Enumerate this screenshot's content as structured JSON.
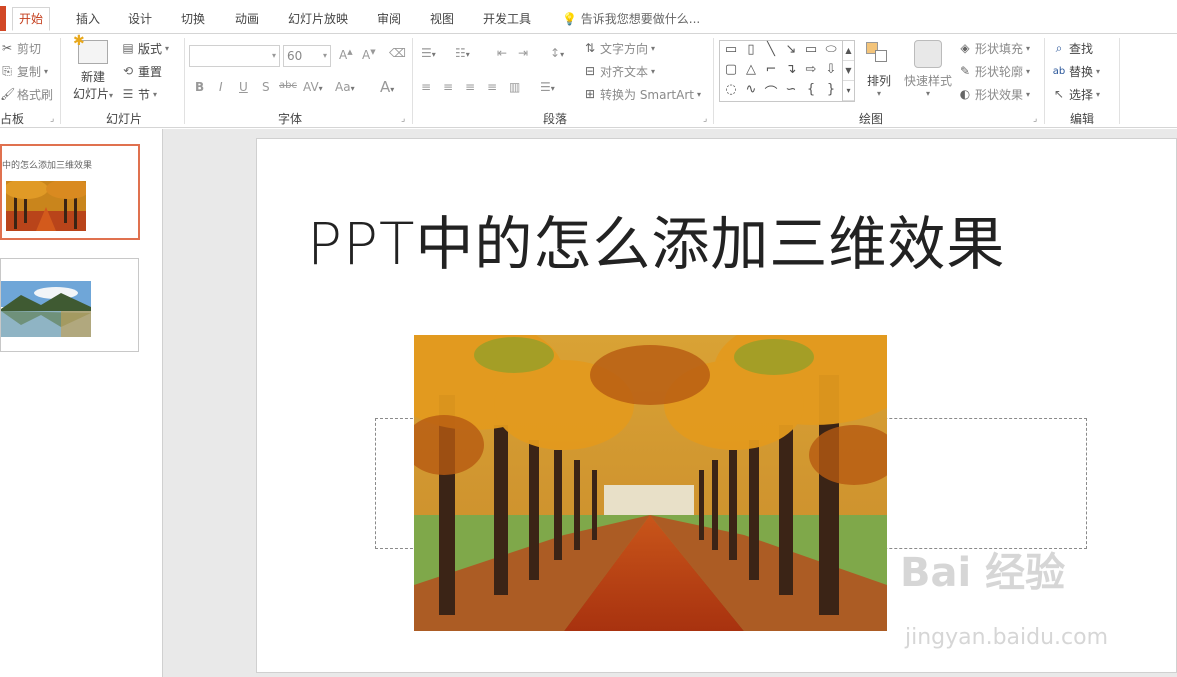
{
  "tabs": [
    "开始",
    "插入",
    "设计",
    "切换",
    "动画",
    "幻灯片放映",
    "审阅",
    "视图",
    "开发工具"
  ],
  "active_tab": "开始",
  "tell_me": "告诉我您想要做什么...",
  "clipboard": {
    "cut": "剪切",
    "copy": "复制",
    "format_painter": "格式刷",
    "label": "占板"
  },
  "slides_group": {
    "new_slide_1": "新建",
    "new_slide_2": "幻灯片",
    "layout": "版式",
    "reset": "重置",
    "section": "节",
    "label": "幻灯片"
  },
  "font_group": {
    "font_name": "",
    "font_size": "60",
    "label": "字体",
    "bold": "B",
    "italic": "I",
    "underline": "U",
    "shadow": "S",
    "strike": "abc",
    "spacing": "AV",
    "case": "Aa",
    "color": "A"
  },
  "paragraph_group": {
    "text_direction": "文字方向",
    "align_text": "对齐文本",
    "convert_smartart": "转换为 SmartArt",
    "label": "段落"
  },
  "drawing_group": {
    "arrange": "排列",
    "quick_styles": "快速样式",
    "shape_fill": "形状填充",
    "shape_outline": "形状轮廓",
    "shape_effects": "形状效果",
    "label": "绘图"
  },
  "editing_group": {
    "find": "查找",
    "replace": "替换",
    "select": "选择",
    "label": "编辑"
  },
  "thumbnails": [
    {
      "number": "1",
      "title": "中的怎么添加三维效果"
    },
    {
      "number": "2",
      "title": ""
    }
  ],
  "slide": {
    "title": "PPT中的怎么添加三维效果"
  },
  "watermark": {
    "brand": "Bai 经验",
    "url": "jingyan.baidu.com"
  },
  "colors": {
    "accent": "#d24726",
    "selected_thumb": "#e0714f"
  }
}
